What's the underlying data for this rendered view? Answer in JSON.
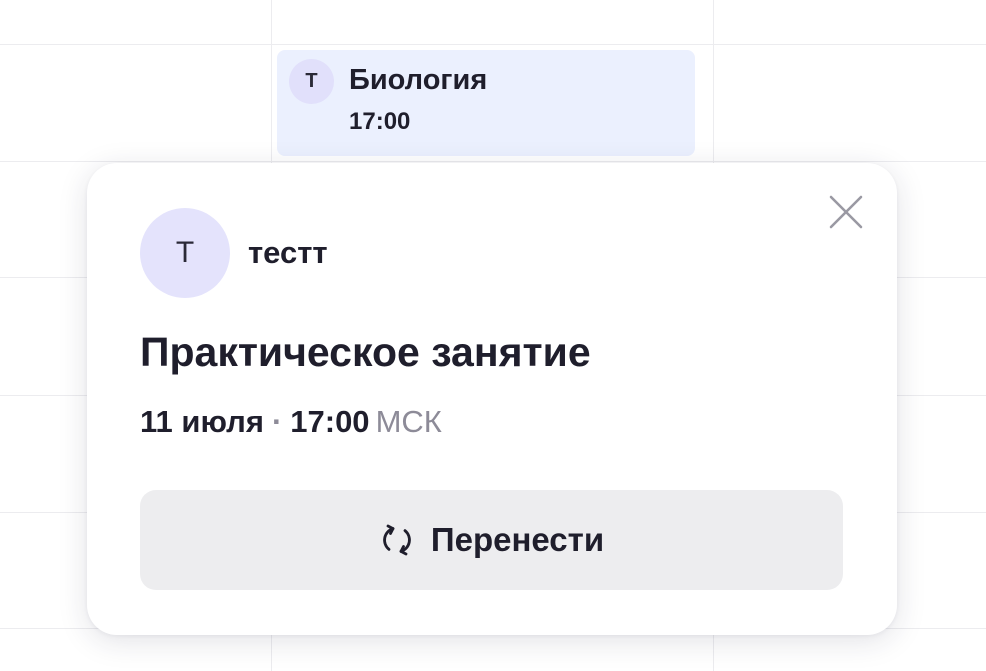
{
  "calendar": {
    "event": {
      "avatar_letter": "Т",
      "title": "Биология",
      "time": "17:00"
    }
  },
  "popover": {
    "avatar_letter": "Т",
    "user_name": "тестт",
    "lesson_title": "Практическое занятие",
    "date": "11 июля",
    "separator": "·",
    "time": "17:00",
    "timezone": "МСК",
    "reschedule_label": "Перенести"
  },
  "colors": {
    "event_bg": "#ebf0fe",
    "avatar_bg": "#e4e3fc",
    "button_bg": "#ededef",
    "text": "#1f1e2c",
    "muted_text": "#8d8b98"
  },
  "icons": {
    "close": "close-icon",
    "reschedule": "refresh-arrows-icon"
  }
}
